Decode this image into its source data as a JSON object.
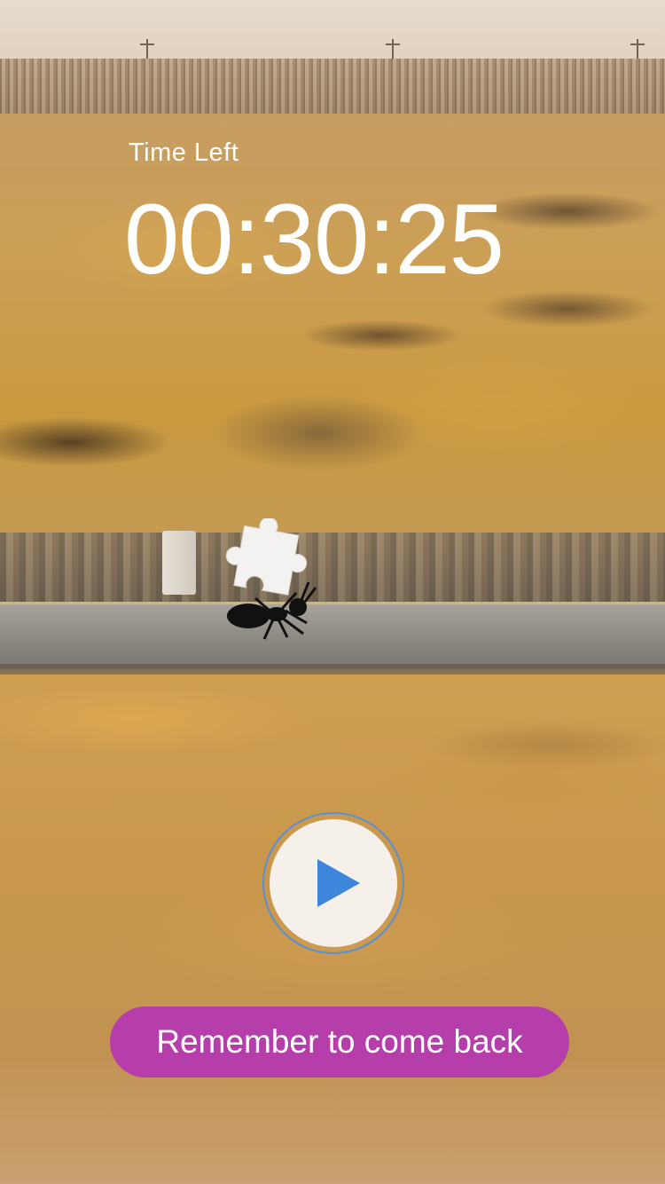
{
  "timer": {
    "label": "Time Left",
    "value": "00:30:25"
  },
  "controls": {
    "play_icon": "play-icon",
    "reminder_label": "Remember to come back"
  },
  "mascot": {
    "icon": "ant-carrying-puzzle-piece"
  },
  "colors": {
    "play_triangle": "#3e86dc",
    "play_ring": "#5b8fd4",
    "reminder_button": "#b63eab",
    "text": "#ffffff"
  }
}
